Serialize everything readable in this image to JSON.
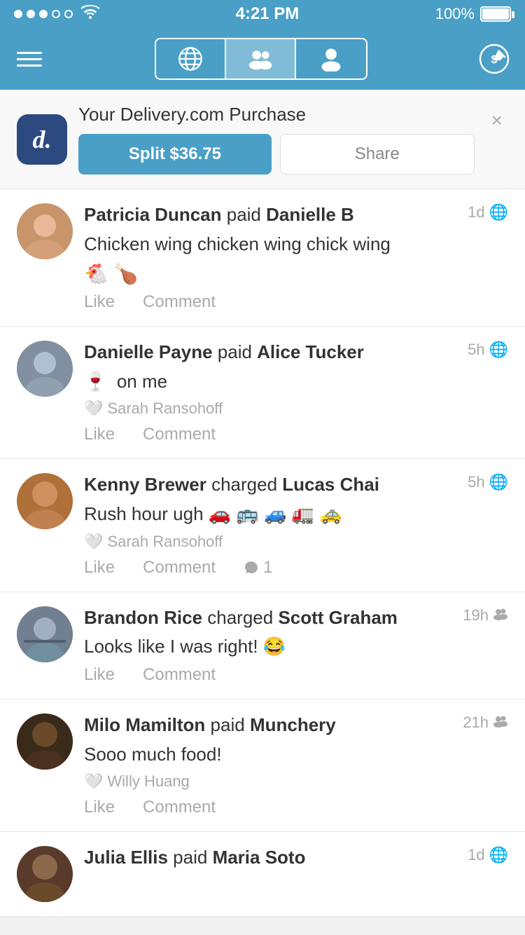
{
  "statusBar": {
    "time": "4:21 PM",
    "battery": "100%"
  },
  "navBar": {
    "menuLabel": "Menu",
    "tabs": [
      {
        "id": "global",
        "label": "Global",
        "active": false
      },
      {
        "id": "friends",
        "label": "Friends",
        "active": false
      },
      {
        "id": "me",
        "label": "Me",
        "active": true
      }
    ],
    "composeLabel": "Compose"
  },
  "promoBanner": {
    "logo": "d.",
    "title": "Your Delivery.com Purchase",
    "splitLabel": "Split $36.75",
    "shareLabel": "Share",
    "closeLabel": "×"
  },
  "feed": [
    {
      "id": 1,
      "actor": "Patricia Duncan",
      "action": "paid",
      "recipient": "Danielle B",
      "time": "1d",
      "visibility": "globe",
      "text": "Chicken wing chicken wing chick wing",
      "emoji": "🐔🍗",
      "likedBy": null,
      "commentCount": null
    },
    {
      "id": 2,
      "actor": "Danielle Payne",
      "action": "paid",
      "recipient": "Alice Tucker",
      "time": "5h",
      "visibility": "globe",
      "text": "🍷  on me",
      "emoji": null,
      "likedBy": "Sarah Ransohoff",
      "commentCount": null
    },
    {
      "id": 3,
      "actor": "Kenny Brewer",
      "action": "charged",
      "recipient": "Lucas Chai",
      "time": "5h",
      "visibility": "globe",
      "text": "Rush hour ugh 🚗 🚌 🚙 🚛 🚕",
      "emoji": null,
      "likedBy": "Sarah Ransohoff",
      "commentCount": "1"
    },
    {
      "id": 4,
      "actor": "Brandon Rice",
      "action": "charged",
      "recipient": "Scott Graham",
      "time": "19h",
      "visibility": "friends",
      "text": "Looks like I was right! 😂",
      "emoji": null,
      "likedBy": null,
      "commentCount": null
    },
    {
      "id": 5,
      "actor": "Milo Mamilton",
      "action": "paid",
      "recipient": "Munchery",
      "time": "21h",
      "visibility": "friends",
      "text": "Sooo much food!",
      "emoji": null,
      "likedBy": "Willy Huang",
      "commentCount": null
    },
    {
      "id": 6,
      "actor": "Julia Ellis",
      "action": "paid",
      "recipient": "Maria Soto",
      "time": "1d",
      "visibility": "globe",
      "text": "",
      "emoji": null,
      "likedBy": null,
      "commentCount": null
    }
  ],
  "actions": {
    "like": "Like",
    "comment": "Comment"
  }
}
